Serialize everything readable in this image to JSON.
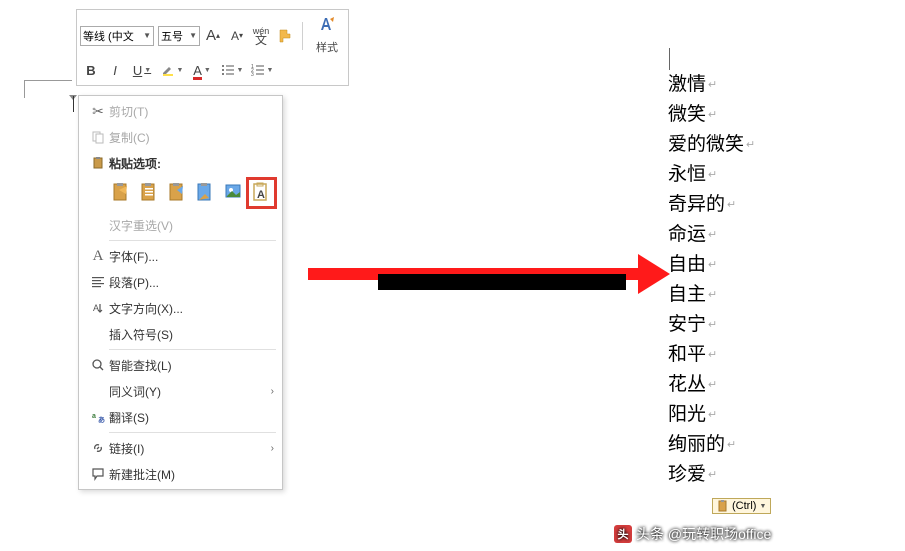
{
  "toolbar": {
    "font_name": "等线 (中文",
    "font_size": "五号",
    "grow_font": "A",
    "shrink_font": "A",
    "phonetic": "wén 文",
    "format_painter": "✓",
    "bold": "B",
    "italic": "I",
    "underline": "U",
    "styles_label": "样式"
  },
  "menu": {
    "cut": "剪切(T)",
    "copy": "复制(C)",
    "paste_options_label": "粘贴选项:",
    "hanzi_reselect": "汉字重选(V)",
    "font": "字体(F)...",
    "paragraph": "段落(P)...",
    "text_direction": "文字方向(X)...",
    "insert_symbol": "插入符号(S)",
    "smart_lookup": "智能查找(L)",
    "synonyms": "同义词(Y)",
    "translate": "翻译(S)",
    "link": "链接(I)",
    "new_comment": "新建批注(M)"
  },
  "words": [
    "激情",
    "微笑",
    "爱的微笑",
    "永恒",
    "奇异的",
    "命运",
    "自由",
    "自主",
    "安宁",
    "和平",
    "花丛",
    "阳光",
    "绚丽的",
    "珍爱"
  ],
  "smart_tag": "(Ctrl)",
  "watermark": "头条 @玩转职场office"
}
